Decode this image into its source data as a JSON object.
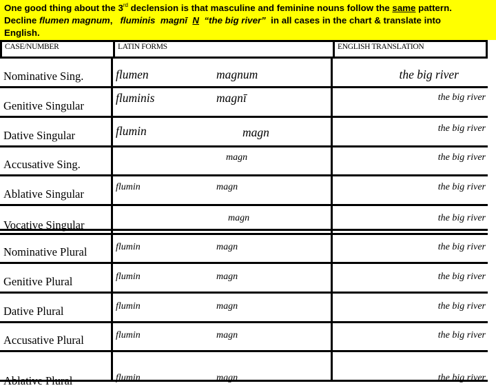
{
  "banner": {
    "line1_a": "One good thing about the 3",
    "line1_sup": "rd",
    "line1_b": " declension is that masculine and feminine nouns follow the ",
    "line1_under": "same",
    "line1_c": " pattern.",
    "line2_a": "Decline ",
    "line2_noun": "flumen  magnum",
    "line2_b": ",   ",
    "line2_gen": "fluminis  magnī",
    "line2_gender": "N",
    "line2_trans": "“the big river”",
    "line2_c": "  in all cases in the chart & translate into",
    "line3": "English."
  },
  "table": {
    "headers": {
      "case": "CASE/NUMBER",
      "latin": "LATIN FORMS",
      "english": "ENGLISH TRANSLATION"
    },
    "rows": [
      {
        "case": "Nominative Sing.",
        "noun": "flumen",
        "adj": "magnum",
        "english": "the big river"
      },
      {
        "case": "Genitive Singular",
        "noun": "fluminis",
        "adj": "magnī",
        "english": "the big river"
      },
      {
        "case": "Dative Singular",
        "noun": "flumin",
        "adj": "magn",
        "english": "the big river"
      },
      {
        "case": "Accusative Sing.",
        "noun": "",
        "adj": "magn",
        "english": "the big river"
      },
      {
        "case": "Ablative Singular",
        "noun": "flumin",
        "adj": "magn",
        "english": "the big river"
      },
      {
        "case": "Vocative Singular",
        "noun": "",
        "adj": "magn",
        "english": "the big river"
      },
      {
        "case": "Nominative Plural",
        "noun": "flumin",
        "adj": "magn",
        "english": "the big river"
      },
      {
        "case": "Genitive Plural",
        "noun": "flumin",
        "adj": "magn",
        "english": "the big river"
      },
      {
        "case": "Dative Plural",
        "noun": "flumin",
        "adj": "magn",
        "english": "the big river"
      },
      {
        "case": "Accusative Plural",
        "noun": "flumin",
        "adj": "magn",
        "english": "the big river"
      },
      {
        "case": "Ablative Plural",
        "noun": "flumin",
        "adj": "magn",
        "english": "the big river"
      }
    ]
  }
}
